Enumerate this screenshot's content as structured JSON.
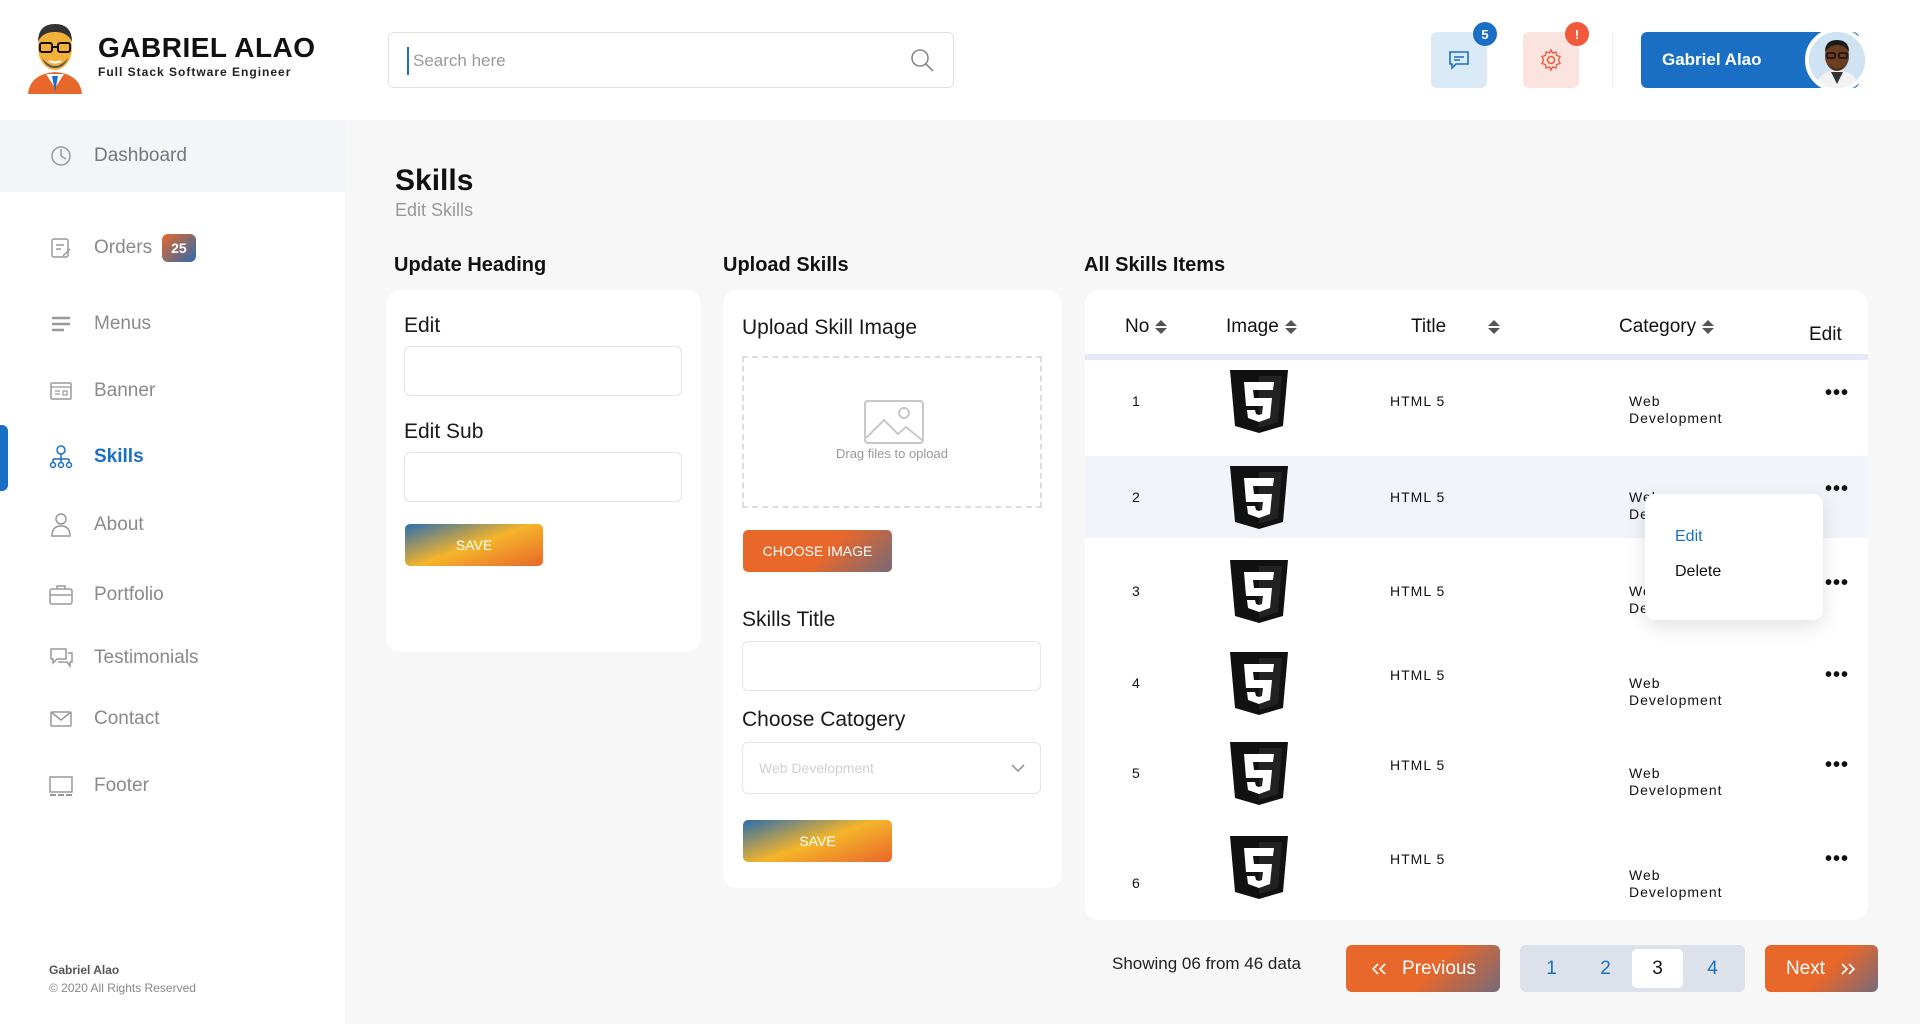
{
  "brand": {
    "name": "GABRIEL ALAO",
    "role": "Full Stack Software Engineer"
  },
  "sidebar": {
    "items": [
      {
        "label": "Dashboard",
        "icon": "dashboard-icon"
      },
      {
        "label": "Orders",
        "icon": "orders-icon",
        "badge": "25"
      },
      {
        "label": "Menus",
        "icon": "menus-icon"
      },
      {
        "label": "Banner",
        "icon": "banner-icon"
      },
      {
        "label": "Skills",
        "icon": "skills-icon",
        "active": true
      },
      {
        "label": "About",
        "icon": "about-icon"
      },
      {
        "label": "Portfolio",
        "icon": "portfolio-icon"
      },
      {
        "label": "Testimonials",
        "icon": "testimonials-icon"
      },
      {
        "label": "Contact",
        "icon": "contact-icon"
      },
      {
        "label": "Footer",
        "icon": "footer-icon"
      }
    ],
    "footer_name": "Gabriel Alao",
    "footer_copy": "© 2020 All Rights Reserved"
  },
  "header": {
    "search_placeholder": "Search here",
    "messages_count": "5",
    "settings_alert": "!",
    "user_name": "Gabriel Alao"
  },
  "page": {
    "title": "Skills",
    "subtitle": "Edit Skills"
  },
  "update_heading": {
    "title": "Update Heading",
    "edit_label": "Edit",
    "edit_sub_label": "Edit Sub",
    "save_label": "SAVE"
  },
  "upload_skills": {
    "title": "Upload Skills",
    "image_label": "Upload Skill Image",
    "drop_text": "Drag files to opload",
    "choose_label": "CHOOSE IMAGE",
    "skills_title_label": "Skills Title",
    "category_label": "Choose Catogery",
    "category_selected": "Web Development",
    "save_label": "SAVE"
  },
  "all_skills": {
    "title": "All Skills Items",
    "columns": {
      "no": "No",
      "image": "Image",
      "title": "Title",
      "category": "Category",
      "edit": "Edit"
    },
    "rows": [
      {
        "no": "1",
        "title": "HTML 5",
        "cat1": "Web",
        "cat2": "Development"
      },
      {
        "no": "2",
        "title": "HTML 5",
        "cat1": "Web",
        "cat2": "Development"
      },
      {
        "no": "3",
        "title": "HTML 5",
        "cat1": "Web",
        "cat2": "Development"
      },
      {
        "no": "4",
        "title": "HTML 5",
        "cat1": "Web",
        "cat2": "Development"
      },
      {
        "no": "5",
        "title": "HTML 5",
        "cat1": "Web",
        "cat2": "Development"
      },
      {
        "no": "6",
        "title": "HTML 5",
        "cat1": "Web",
        "cat2": "Development"
      }
    ],
    "more": "•••",
    "menu": {
      "edit": "Edit",
      "delete": "Delete"
    }
  },
  "pagination": {
    "showing": "Showing 06 from 46 data",
    "previous": "Previous",
    "next": "Next",
    "pages": [
      "1",
      "2",
      "3",
      "4"
    ],
    "current": "3"
  },
  "colors": {
    "primary": "#1a6fc5",
    "accent": "#e8672a",
    "yellow": "#f5b52a"
  }
}
